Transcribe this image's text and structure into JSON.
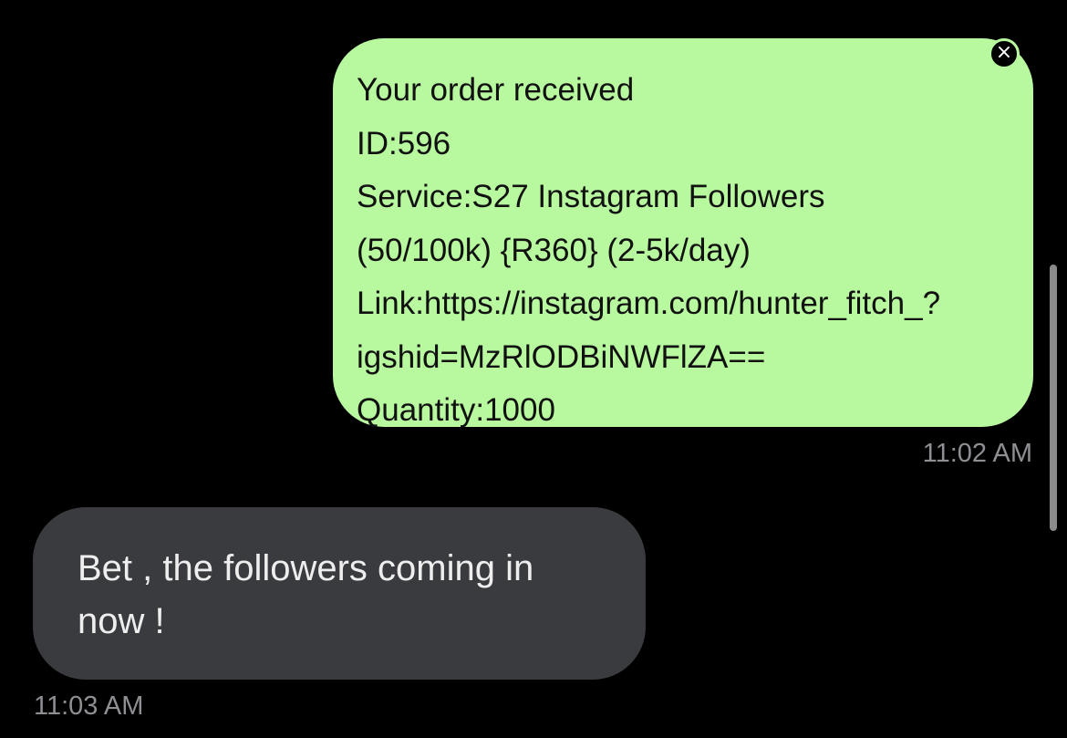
{
  "conversation": {
    "sent_message": {
      "lines": [
        "Your order received",
        "ID:596",
        "Service:S27 Instagram Followers",
        "(50/100k) {R360} (2-5k/day)",
        "Link:https://instagram.com/hunter_fitch_?",
        "igshid=MzRlODBiNWFlZA==",
        "Quantity:1000"
      ],
      "timestamp": "11:02 AM",
      "dismiss_icon": "×"
    },
    "received_message": {
      "lines": [
        "Bet , the followers coming in",
        "now !"
      ],
      "timestamp": "11:03 AM"
    }
  },
  "colors": {
    "background": "#000000",
    "sent_bubble": "#b8f99f",
    "received_bubble": "#3a3b3e",
    "timestamp_text": "#8e8e93"
  },
  "icons": {
    "dismiss": "close-icon"
  }
}
